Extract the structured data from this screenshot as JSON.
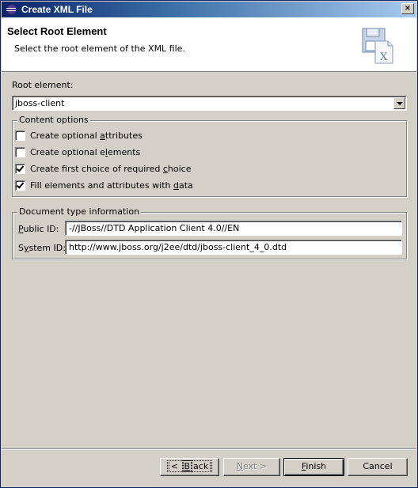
{
  "window": {
    "title": "Create XML File",
    "close_glyph": "×"
  },
  "banner": {
    "title": "Select Root Element",
    "description": "Select the root element of the XML file.",
    "icon": "xml-file-wizard-icon"
  },
  "root_element": {
    "label": "Root element:",
    "value": "jboss-client"
  },
  "content_options": {
    "title": "Content options",
    "items": [
      {
        "label_pre": "Create optional ",
        "label_u": "a",
        "label_post": "ttributes",
        "checked": false
      },
      {
        "label_pre": "Create optional e",
        "label_u": "l",
        "label_post": "ements",
        "checked": false
      },
      {
        "label_pre": "Create first choice of required ",
        "label_u": "c",
        "label_post": "hoice",
        "checked": true
      },
      {
        "label_pre": "Fill elements and attributes with ",
        "label_u": "d",
        "label_post": "ata",
        "checked": true
      }
    ]
  },
  "doctype": {
    "title": "Document type information",
    "public_id_label_u": "P",
    "public_id_label_rest": "ublic ID:",
    "public_id_value": "-//JBoss//DTD Application Client 4.0//EN",
    "system_id_label_pre": "S",
    "system_id_label_u": "y",
    "system_id_label_rest": "stem ID:",
    "system_id_value": "http://www.jboss.org/j2ee/dtd/jboss-client_4_0.dtd"
  },
  "buttons": {
    "back_pre": "< ",
    "back_u": "B",
    "back_post": "ack",
    "next_pre": "",
    "next_u": "N",
    "next_post": "ext >",
    "finish_u": "F",
    "finish_post": "inish",
    "cancel": "Cancel"
  }
}
